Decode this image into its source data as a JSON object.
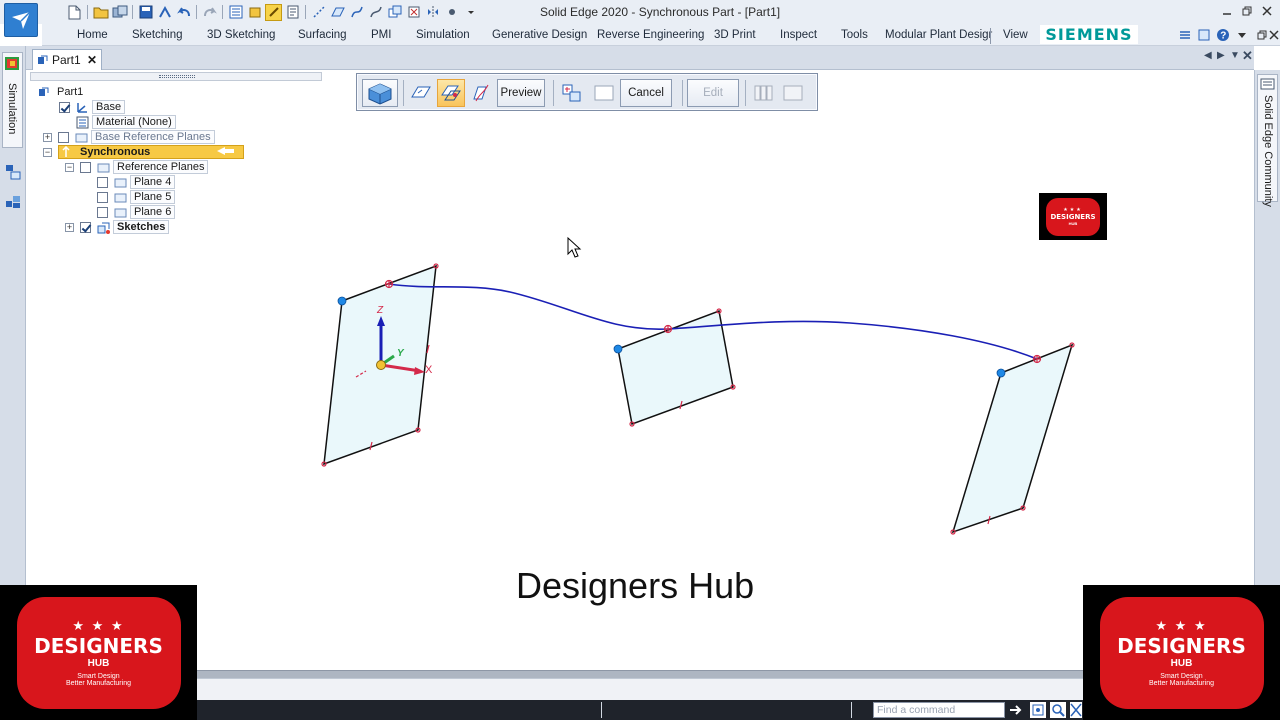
{
  "window": {
    "title": "Solid Edge 2020 - Synchronous Part - [Part1]"
  },
  "ribbon": {
    "tabs": [
      "Home",
      "Sketching",
      "3D Sketching",
      "Surfacing",
      "PMI",
      "Simulation",
      "Generative Design",
      "Reverse Engineering",
      "3D Print",
      "Inspect",
      "Tools",
      "Modular Plant Desigr",
      "View"
    ],
    "brand": "SIEMENS"
  },
  "left_rail": {
    "tab_label": "Simulation"
  },
  "right_rail": {
    "tab_label": "Solid Edge Community"
  },
  "document": {
    "tab_label": "Part1"
  },
  "pathfinder": {
    "root": "Part1",
    "base": "Base",
    "material": "Material (None)",
    "base_ref_planes": "Base Reference Planes",
    "synchronous": "Synchronous",
    "reference_planes": "Reference Planes",
    "planes": [
      "Plane 4",
      "Plane 5",
      "Plane 6"
    ],
    "sketches": "Sketches"
  },
  "command_bar": {
    "preview": "Preview",
    "cancel": "Cancel",
    "edit": "Edit"
  },
  "triad": {
    "x": "X",
    "y": "Y",
    "z": "Z"
  },
  "watermark": {
    "name": "DESIGNERS",
    "sub": "HUB",
    "tagline_1": "Smart Design",
    "tagline_2": "Better Manufacturing",
    "small_name": "DESIGNERS",
    "small_sub": "HUB"
  },
  "overlay_title": "Designers Hub",
  "statusbar": {
    "find_placeholder": "Find a command"
  },
  "colors": {
    "accent_blue": "#2f7fd1",
    "curve_blue": "#1a1fb5",
    "plane_fill": "#eaf8fb",
    "handle_red": "#d42a4a",
    "selection_yellow": "#f7c944",
    "brand_teal": "#009999",
    "badge_red": "#d8161c"
  }
}
